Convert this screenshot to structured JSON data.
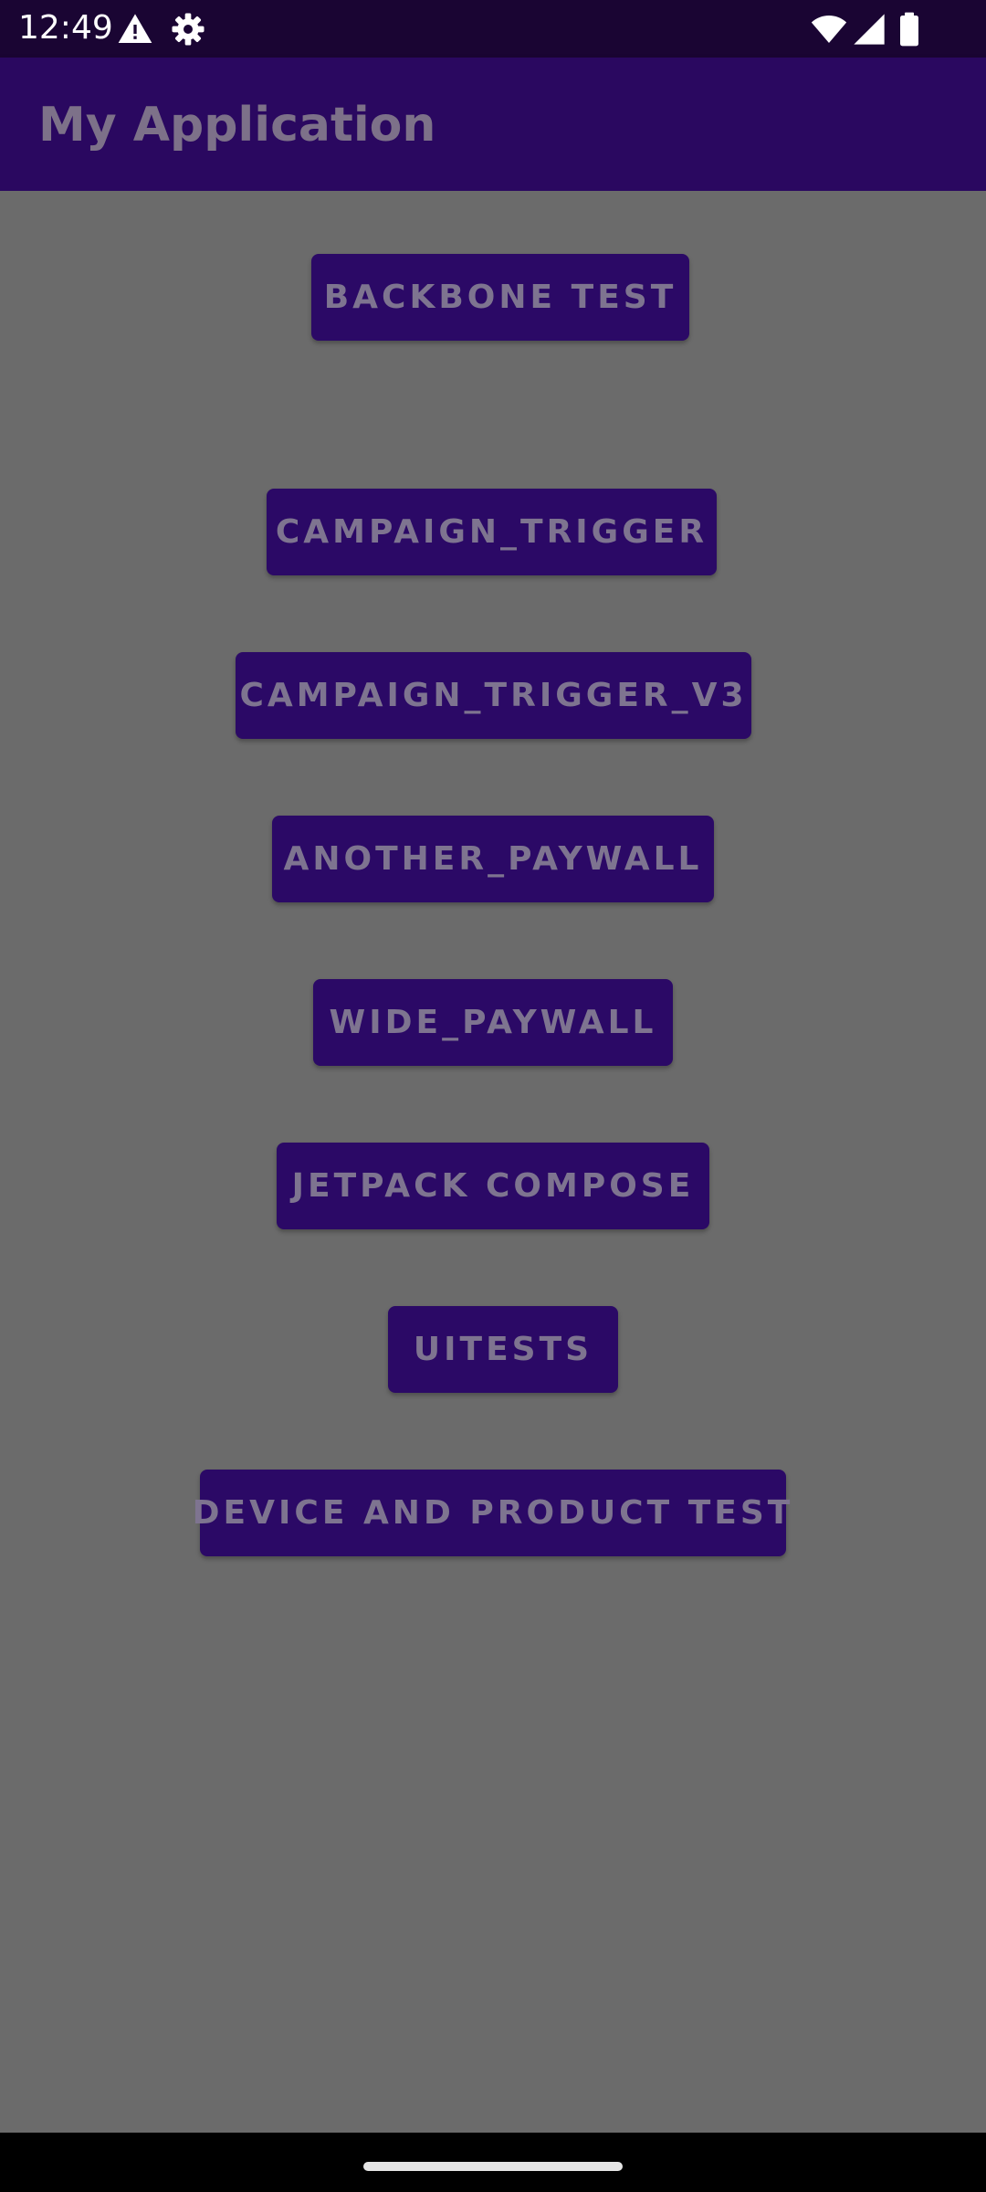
{
  "status_bar": {
    "time": "12:49",
    "left_icons": [
      "warning-icon",
      "gear-icon"
    ],
    "right_icons": [
      "wifi-icon",
      "signal-icon",
      "battery-icon"
    ]
  },
  "app_bar": {
    "title": "My Application"
  },
  "buttons": [
    {
      "label": "BACKBONE TEST"
    },
    {
      "label": "CAMPAIGN_TRIGGER"
    },
    {
      "label": "CAMPAIGN_TRIGGER_V3"
    },
    {
      "label": "ANOTHER_PAYWALL"
    },
    {
      "label": "WIDE_PAYWALL"
    },
    {
      "label": "JETPACK COMPOSE"
    },
    {
      "label": "UITESTS"
    },
    {
      "label": "DEVICE AND PRODUCT TEST"
    }
  ],
  "colors": {
    "status_bar_bg": "#1a0533",
    "app_bar_bg": "#2a0860",
    "button_bg": "#2b0966",
    "content_bg": "#6b6b6b",
    "nav_bar_bg": "#000000"
  }
}
